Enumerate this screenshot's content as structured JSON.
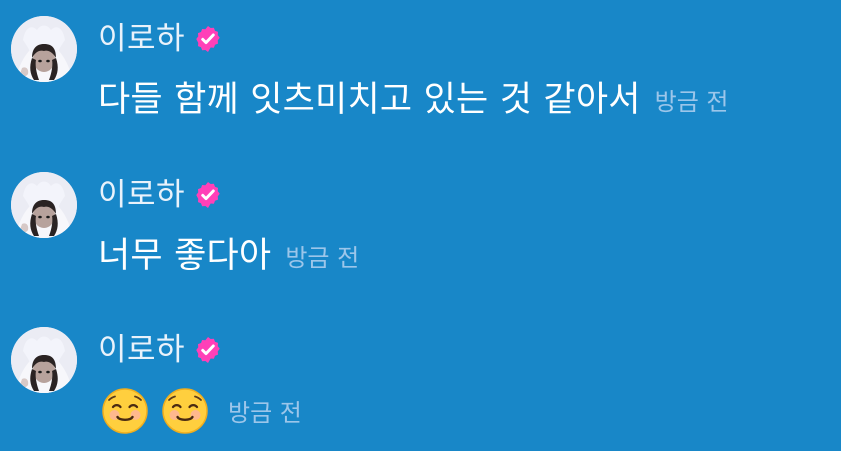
{
  "colors": {
    "background": "#1887c8",
    "name": "#e9f2fb",
    "message": "#ffffff",
    "timestamp": "#9cc6ea",
    "verified_badge": "#ff40b8"
  },
  "messages": [
    {
      "sender": "이로하",
      "text": "다들 함께 잇츠미치고 있는 것 같아서",
      "time": "방금 전",
      "avatar_icon": "profile-avatar",
      "badge_icon": "verified-check-icon"
    },
    {
      "sender": "이로하",
      "text": "너무 좋다아",
      "time": "방금 전",
      "avatar_icon": "profile-avatar",
      "badge_icon": "verified-check-icon"
    },
    {
      "sender": "이로하",
      "emojis": [
        "smiling-face-emoji",
        "smiling-face-emoji"
      ],
      "time": "방금 전",
      "avatar_icon": "profile-avatar",
      "badge_icon": "verified-check-icon"
    }
  ]
}
